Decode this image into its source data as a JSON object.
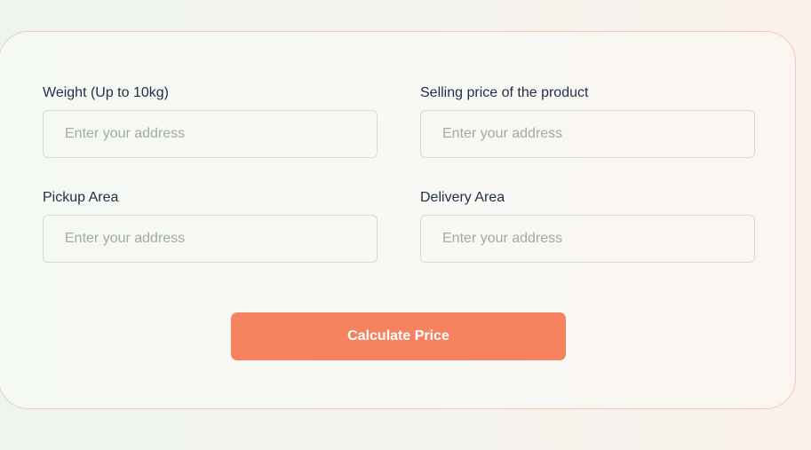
{
  "form": {
    "weight": {
      "label": "Weight (Up to 10kg)",
      "placeholder": "Enter your address",
      "value": ""
    },
    "selling_price": {
      "label": "Selling price of the product",
      "placeholder": "Enter your address",
      "value": ""
    },
    "pickup_area": {
      "label": "Pickup Area",
      "placeholder": "Enter your address",
      "value": ""
    },
    "delivery_area": {
      "label": "Delivery Area",
      "placeholder": "Enter your address",
      "value": ""
    },
    "submit_label": "Calculate Price"
  },
  "colors": {
    "accent": "#f7825f",
    "label_text": "#1f2f4a",
    "card_border": "#f4c9b8"
  }
}
